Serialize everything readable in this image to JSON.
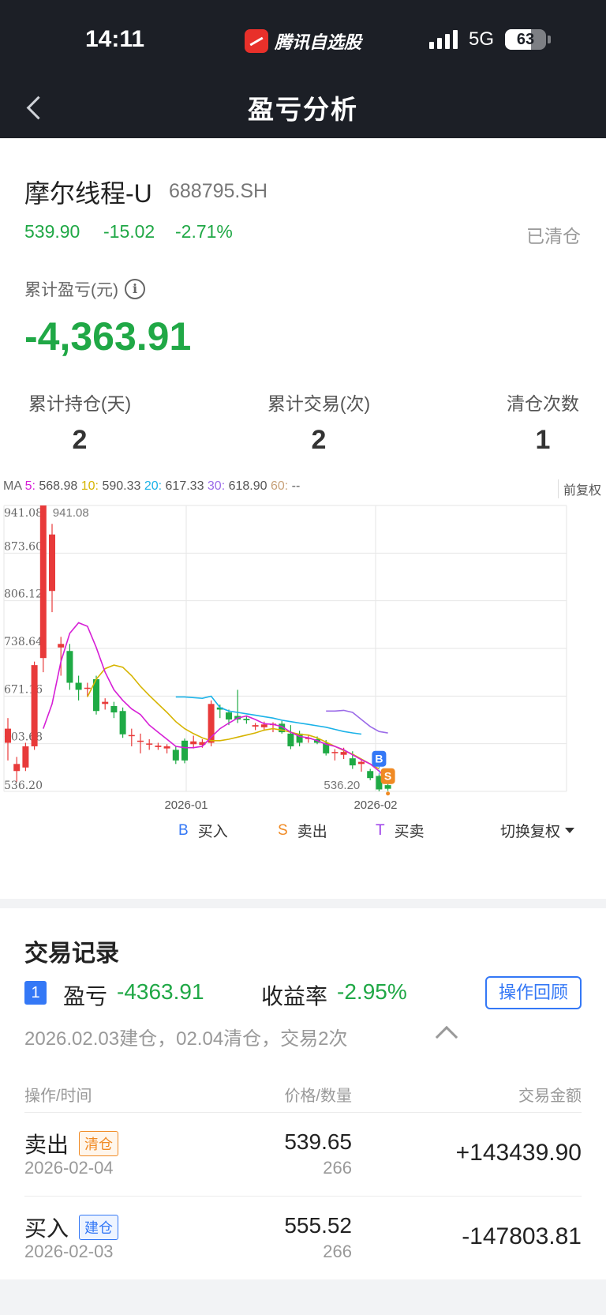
{
  "status_bar": {
    "time": "14:11",
    "app_name": "腾讯自选股",
    "network": "5G",
    "battery": "63",
    "battery_level_percent": 63
  },
  "header": {
    "title": "盈亏分析"
  },
  "stock": {
    "name": "摩尔线程-U",
    "code": "688795.SH",
    "price": "539.90",
    "change": "-15.02",
    "change_pct": "-2.71%",
    "status": "已清仓"
  },
  "summary": {
    "cum_pl_label": "累计盈亏(元)",
    "info_icon": "i",
    "cum_pl_value": "-4,363.91"
  },
  "stats": [
    {
      "label": "累计持仓(天)",
      "value": "2"
    },
    {
      "label": "累计交易(次)",
      "value": "2"
    },
    {
      "label": "清仓次数",
      "value": "1"
    }
  ],
  "ma_legend": {
    "prefix": "MA",
    "items": [
      {
        "label": "5:",
        "value": "568.98",
        "color": "#d61fd6"
      },
      {
        "label": "10:",
        "value": "590.33",
        "color": "#d6b400"
      },
      {
        "label": "20:",
        "value": "617.33",
        "color": "#1ab2e8"
      },
      {
        "label": "30:",
        "value": "618.90",
        "color": "#9b6be8"
      },
      {
        "label": "60:",
        "value": "--",
        "color": "#c8a27a"
      }
    ]
  },
  "adjust_label": "前复权",
  "chart_data": {
    "type": "candlestick",
    "y_ticks": [
      "941.08",
      "873.60",
      "806.12",
      "738.64",
      "671.16",
      "603.68",
      "536.20"
    ],
    "x_ticks": [
      "2026-01",
      "2026-02"
    ],
    "ylim": [
      536.2,
      941.08
    ],
    "high_label": "941.08",
    "low_label": "536.20",
    "candles": [
      [
        605,
        625,
        580,
        640
      ],
      [
        565,
        575,
        550,
        585
      ],
      [
        570,
        600,
        565,
        605
      ],
      [
        600,
        715,
        595,
        720
      ],
      [
        725,
        941.08,
        705,
        941.08
      ],
      [
        820,
        900,
        790,
        915
      ],
      [
        740,
        745,
        700,
        755
      ],
      [
        735,
        690,
        680,
        745
      ],
      [
        690,
        680,
        665,
        700
      ],
      [
        683,
        683,
        670,
        690
      ],
      [
        695,
        650,
        645,
        700
      ],
      [
        660,
        663,
        652,
        668
      ],
      [
        657,
        648,
        640,
        663
      ],
      [
        650,
        617,
        612,
        655
      ],
      [
        616,
        616,
        600,
        625
      ],
      [
        608,
        608,
        590,
        618
      ],
      [
        604,
        604,
        595,
        610
      ],
      [
        599,
        601,
        595,
        605
      ],
      [
        597,
        600,
        590,
        603
      ],
      [
        595,
        580,
        575,
        600
      ],
      [
        608,
        580,
        576,
        611
      ],
      [
        603,
        607,
        597,
        615
      ],
      [
        602,
        606,
        598,
        610
      ],
      [
        605,
        660,
        600,
        665
      ],
      [
        655,
        652,
        640,
        659
      ],
      [
        648,
        638,
        630,
        652
      ],
      [
        643,
        638,
        633,
        680
      ],
      [
        639,
        637,
        632,
        642
      ],
      [
        628,
        630,
        623,
        633
      ],
      [
        627,
        631,
        622,
        635
      ],
      [
        630,
        632,
        620,
        634
      ],
      [
        632,
        620,
        618,
        636
      ],
      [
        618,
        600,
        596,
        630
      ],
      [
        618,
        605,
        600,
        622
      ],
      [
        612,
        612,
        605,
        616
      ],
      [
        610,
        605,
        603,
        614
      ],
      [
        605,
        590,
        587,
        609
      ],
      [
        591,
        592,
        580,
        596
      ],
      [
        588,
        592,
        582,
        598
      ],
      [
        583,
        573,
        568,
        593
      ],
      [
        575,
        578,
        564,
        582
      ],
      [
        565,
        555,
        552,
        568
      ],
      [
        558,
        539,
        536.2,
        560
      ],
      [
        545,
        539.9,
        537,
        548
      ]
    ],
    "ma5": [
      null,
      null,
      null,
      null,
      625,
      660,
      720,
      760,
      775,
      770,
      740,
      705,
      680,
      665,
      653,
      645,
      630,
      620,
      610,
      600,
      598,
      598,
      600,
      613,
      625,
      633,
      640,
      643,
      638,
      632,
      631,
      628,
      620,
      614,
      612,
      608,
      603,
      600,
      595,
      588,
      581,
      575,
      565,
      552
    ],
    "ma10": [
      null,
      null,
      null,
      null,
      null,
      null,
      null,
      null,
      null,
      670,
      695,
      710,
      715,
      712,
      700,
      685,
      672,
      660,
      648,
      635,
      625,
      618,
      612,
      608,
      608,
      610,
      613,
      616,
      619,
      623,
      625,
      623,
      620,
      617,
      616,
      612,
      606,
      600,
      594,
      589,
      582,
      575,
      568
    ],
    "ma20": [
      null,
      null,
      null,
      null,
      null,
      null,
      null,
      null,
      null,
      null,
      null,
      null,
      null,
      null,
      null,
      null,
      null,
      null,
      null,
      670,
      670,
      669,
      668,
      671,
      655,
      650,
      648,
      646,
      644,
      642,
      640,
      637,
      635,
      633,
      631,
      629,
      627,
      624,
      621,
      619,
      617.33
    ],
    "ma30": [
      null,
      null,
      null,
      null,
      null,
      null,
      null,
      null,
      null,
      null,
      null,
      null,
      null,
      null,
      null,
      null,
      null,
      null,
      null,
      null,
      null,
      null,
      null,
      null,
      null,
      null,
      null,
      null,
      null,
      null,
      null,
      null,
      null,
      null,
      null,
      null,
      650,
      650,
      651,
      648,
      638,
      628,
      621,
      618.9
    ],
    "buy_marker": {
      "label": "B",
      "color": "#3478f6"
    },
    "sell_marker": {
      "label": "S",
      "color": "#f08a24"
    }
  },
  "legend": {
    "buy": {
      "symbol": "B",
      "text": "买入",
      "color": "#3478f6"
    },
    "sell": {
      "symbol": "S",
      "text": "卖出",
      "color": "#f08a24"
    },
    "both": {
      "symbol": "T",
      "text": "买卖",
      "color": "#9b3be8"
    },
    "switch": "切换复权"
  },
  "records": {
    "title": "交易记录",
    "index": "1",
    "pl_label": "盈亏",
    "pl_value": "-4363.91",
    "yield_label": "收益率",
    "yield_value": "-2.95%",
    "review_button": "操作回顾",
    "summary": "2026.02.03建仓，02.04清仓，交易2次",
    "columns": [
      "操作/时间",
      "价格/数量",
      "交易金额"
    ],
    "rows": [
      {
        "action": "卖出",
        "tag": "清仓",
        "date": "2026-02-04",
        "price": "539.65",
        "qty": "266",
        "amount": "+143439.90"
      },
      {
        "action": "买入",
        "tag": "建仓",
        "date": "2026-02-03",
        "price": "555.52",
        "qty": "266",
        "amount": "-147803.81"
      }
    ]
  }
}
